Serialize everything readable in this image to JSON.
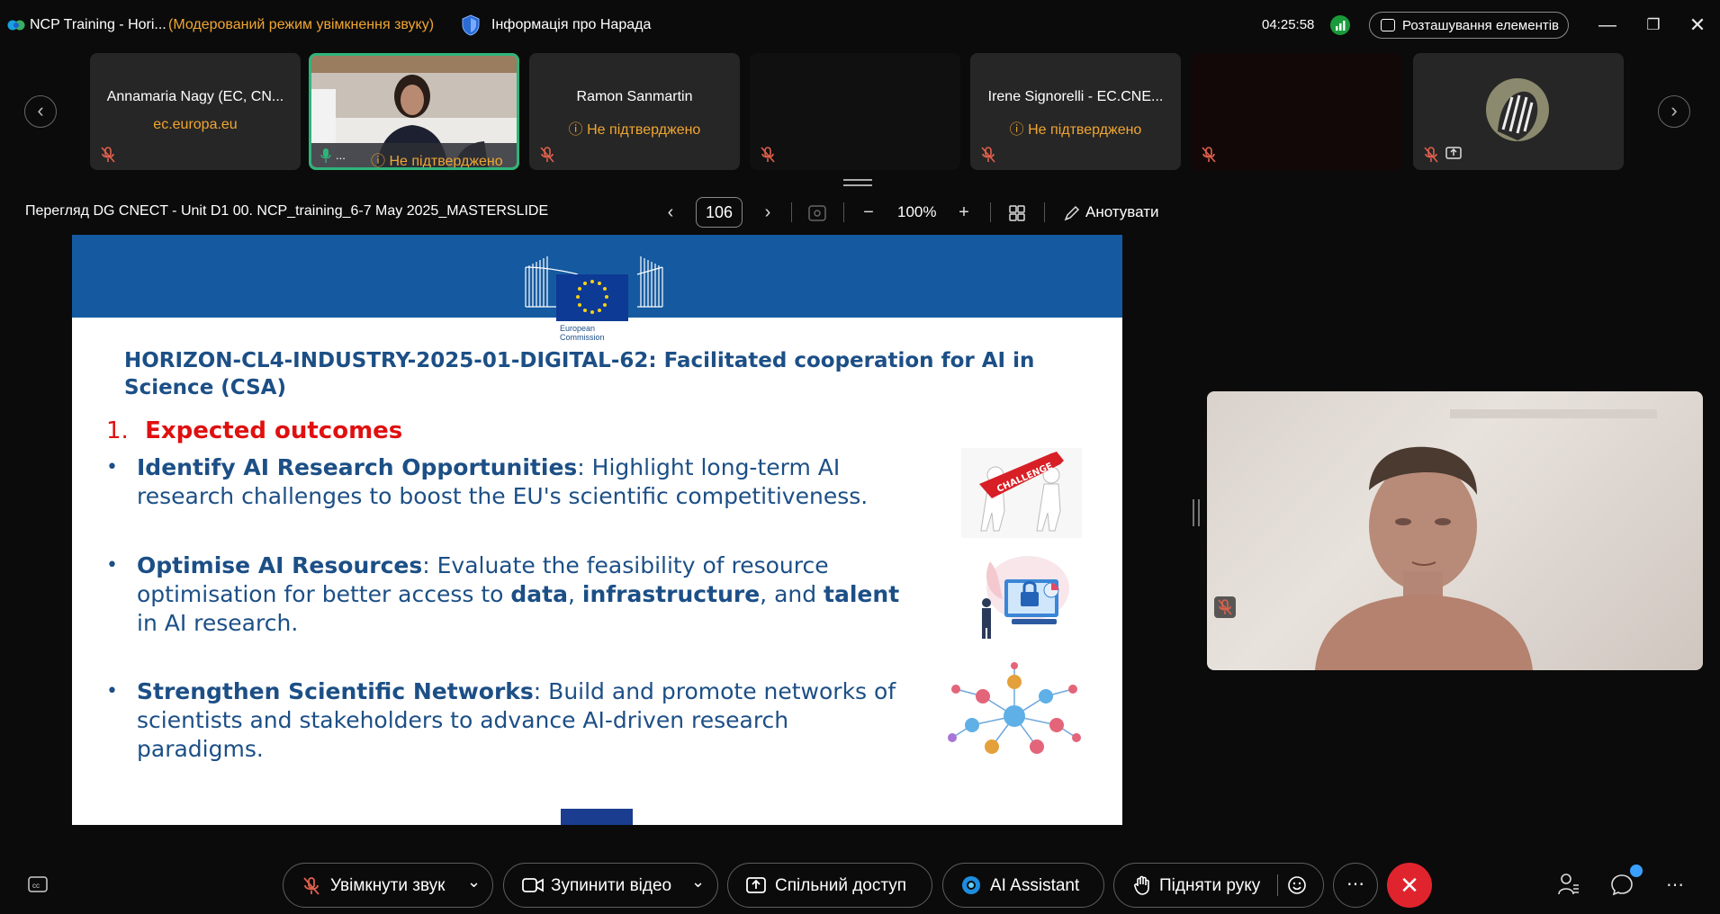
{
  "titlebar": {
    "app_title": "NCP Training - Hori...",
    "mode_notice": "(Модерований режим увімкнення звуку)",
    "meeting_info": "Інформація про Нарада",
    "clock": "04:25:58",
    "layout_button": "Розташування елементів"
  },
  "participants": [
    {
      "name": "Annamaria Nagy (EC, CN...",
      "status": "ec.europa.eu",
      "muted": true
    },
    {
      "name": "...",
      "status": "Не підтверджено",
      "muted": false,
      "video": true,
      "active": true
    },
    {
      "name": "Ramon Sanmartin",
      "status": "Не підтверджено",
      "muted": true
    },
    {
      "name": "",
      "status": "",
      "muted": true
    },
    {
      "name": "Irene Signorelli -  EC.CNE...",
      "status": "Не підтверджено",
      "muted": true
    },
    {
      "name": "",
      "status": "",
      "muted": true
    },
    {
      "name": "",
      "status": "",
      "muted": true,
      "avatar": true
    }
  ],
  "viewer": {
    "title": "Перегляд DG CNECT - Unit D1 00. NCP_training_6-7 May 2025_MASTERSLIDE",
    "page": "106",
    "zoom": "100%",
    "annotate": "Анотувати"
  },
  "slide": {
    "logo_text_1": "European",
    "logo_text_2": "Commission",
    "title": "HORIZON-CL4-INDUSTRY-2025-01-DIGITAL-62: Facilitated cooperation for AI in Science (CSA)",
    "section_number": "1.",
    "section_title": "Expected outcomes",
    "bullets": [
      {
        "bold": "Identify AI Research Opportunities",
        "rest": ": Highlight long-term AI research challenges to boost the EU's scientific competitiveness."
      },
      {
        "bold": "Optimise AI Resources",
        "rest_1": ": Evaluate the feasibility of resource optimisation for better access to ",
        "bold_2": "data",
        "sep_1": ", ",
        "bold_3": "infrastructure",
        "sep_2": ", and ",
        "bold_4": "talent",
        "rest_2": " in AI research."
      },
      {
        "bold": "Strengthen Scientific Networks",
        "rest": ": Build and promote networks of scientists and stakeholders to advance AI-driven research paradigms."
      }
    ],
    "challenge_label": "CHALLENGE"
  },
  "controls": {
    "unmute": "Увімкнути звук",
    "stop_video": "Зупинити відео",
    "share": "Спільний доступ",
    "ai_assistant": "AI Assistant",
    "raise_hand": "Підняти руку"
  },
  "colors": {
    "accent_orange": "#f0a632",
    "slide_blue": "#1c4f86",
    "band_blue": "#155aa0",
    "end_red": "#e0242e",
    "active_green": "#2fb47a"
  }
}
